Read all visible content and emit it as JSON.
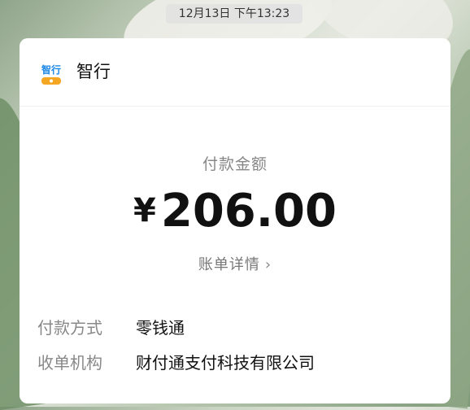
{
  "timestamp": "12月13日 下午13:23",
  "app": {
    "name": "智行",
    "logo_icon": "zhixing-logo-icon",
    "brand_color": "#1e88e5"
  },
  "payment": {
    "amount_label": "付款金额",
    "currency_symbol": "¥",
    "amount": "206.00",
    "details_link": "账单详情"
  },
  "rows": [
    {
      "key": "付款方式",
      "value": "零钱通"
    },
    {
      "key": "收单机构",
      "value": "财付通支付科技有限公司"
    }
  ]
}
